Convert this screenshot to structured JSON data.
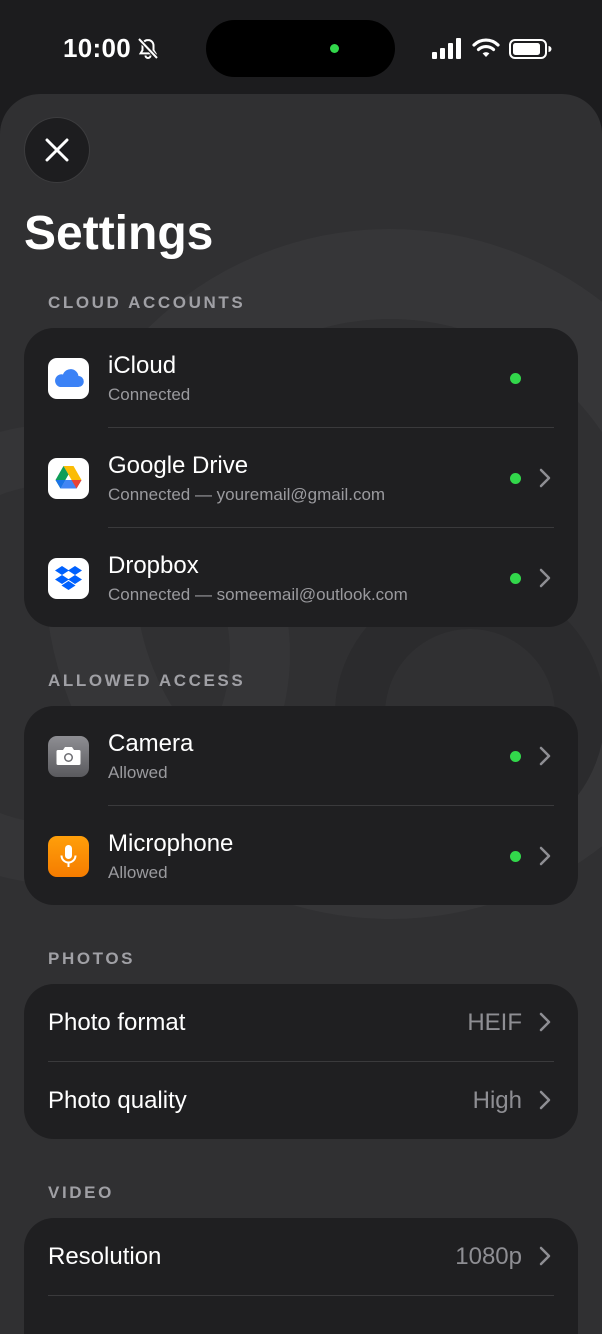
{
  "status_bar": {
    "time": "10:00"
  },
  "page": {
    "title": "Settings"
  },
  "cloud_accounts": {
    "header": "CLOUD ACCOUNTS",
    "items": [
      {
        "label": "iCloud",
        "status": "Connected",
        "icon": "icloud-icon",
        "has_chevron": false
      },
      {
        "label": "Google Drive",
        "status": "Connected — youremail@gmail.com",
        "icon": "google-drive-icon",
        "has_chevron": true
      },
      {
        "label": "Dropbox",
        "status": "Connected — someemail@outlook.com",
        "icon": "dropbox-icon",
        "has_chevron": true
      }
    ]
  },
  "allowed_access": {
    "header": "ALLOWED ACCESS",
    "items": [
      {
        "label": "Camera",
        "status": "Allowed",
        "icon": "camera-icon"
      },
      {
        "label": "Microphone",
        "status": "Allowed",
        "icon": "microphone-icon"
      }
    ]
  },
  "photos": {
    "header": "PHOTOS",
    "items": [
      {
        "label": "Photo format",
        "value": "HEIF"
      },
      {
        "label": "Photo quality",
        "value": "High"
      }
    ]
  },
  "video": {
    "header": "VIDEO",
    "items": [
      {
        "label": "Resolution",
        "value": "1080p"
      }
    ]
  },
  "colors": {
    "accent_green": "#32d74b",
    "card_bg": "#1f1f21",
    "sheet_bg": "#303032",
    "secondary_text": "#9a9a9e"
  }
}
